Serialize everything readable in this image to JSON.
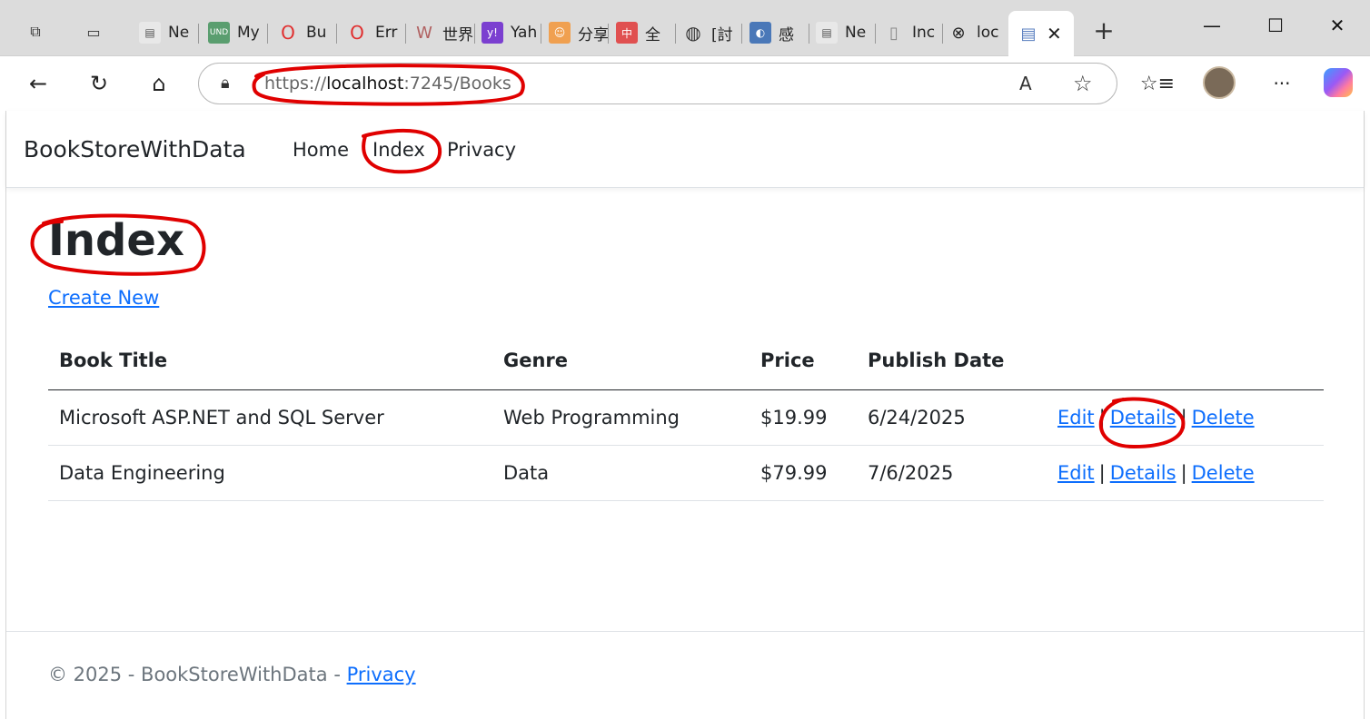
{
  "browser": {
    "tabs": [
      {
        "label": "Ne",
        "favicon": "page-icon",
        "fav_bg": "#e8e8e8",
        "fav_fg": "#555"
      },
      {
        "label": "My",
        "favicon": "UND",
        "fav_bg": "#5a9e6f",
        "fav_fg": "#ffffff"
      },
      {
        "label": "Bu",
        "favicon": "opera-icon",
        "fav_bg": "#dcdcdc",
        "fav_fg": "#e03030"
      },
      {
        "label": "Err",
        "favicon": "opera-icon",
        "fav_bg": "#dcdcdc",
        "fav_fg": "#e03030"
      },
      {
        "label": "世界",
        "favicon": "W",
        "fav_bg": "#dcdcdc",
        "fav_fg": "#b06060"
      },
      {
        "label": "Yah",
        "favicon": "y!",
        "fav_bg": "#7b3fd0",
        "fav_fg": "#ffffff"
      },
      {
        "label": "分享",
        "favicon": "smile-icon",
        "fav_bg": "#f0a050",
        "fav_fg": "#ffffff"
      },
      {
        "label": "全",
        "favicon": "中",
        "fav_bg": "#e05050",
        "fav_fg": "#ffffff"
      },
      {
        "label": "[討",
        "favicon": "globe-icon",
        "fav_bg": "#dcdcdc",
        "fav_fg": "#333"
      },
      {
        "label": "感",
        "favicon": "app-icon",
        "fav_bg": "#4a78b8",
        "fav_fg": "#ffffff"
      },
      {
        "label": "Ne",
        "favicon": "page-icon",
        "fav_bg": "#e8e8e8",
        "fav_fg": "#555"
      },
      {
        "label": "Inc",
        "favicon": "doc-icon",
        "fav_bg": "#dcdcdc",
        "fav_fg": "#888"
      },
      {
        "label": "loc",
        "favicon": "doc-error-icon",
        "fav_bg": "#dcdcdc",
        "fav_fg": "#222"
      }
    ],
    "active_tab_favicon": "doc-icon",
    "close_glyph": "✕",
    "new_tab_glyph": "+",
    "window_controls": {
      "minimize": "—",
      "maximize": "☐",
      "close": "✕"
    },
    "url_scheme": "https://",
    "url_host": "localhost",
    "url_rest": ":7245/Books",
    "read_aloud_glyph": "A",
    "more_glyph": "···"
  },
  "site": {
    "brand": "BookStoreWithData",
    "nav": [
      "Home",
      "Index",
      "Privacy"
    ]
  },
  "page": {
    "title": "Index",
    "create_new": "Create New",
    "columns": [
      "Book Title",
      "Genre",
      "Price",
      "Publish Date"
    ],
    "rows": [
      {
        "title": "Microsoft ASP.NET and SQL Server",
        "genre": "Web Programming",
        "price": "$19.99",
        "date": "6/24/2025"
      },
      {
        "title": "Data Engineering",
        "genre": "Data",
        "price": "$79.99",
        "date": "7/6/2025"
      }
    ],
    "actions": {
      "edit": "Edit",
      "details": "Details",
      "delete": "Delete",
      "separator": "|"
    }
  },
  "footer": {
    "text": "© 2025 - BookStoreWithData - ",
    "privacy": "Privacy"
  },
  "colors": {
    "link": "#0d6efd",
    "text": "#212529",
    "muted": "#6c757d",
    "annotation": "#e00000"
  }
}
